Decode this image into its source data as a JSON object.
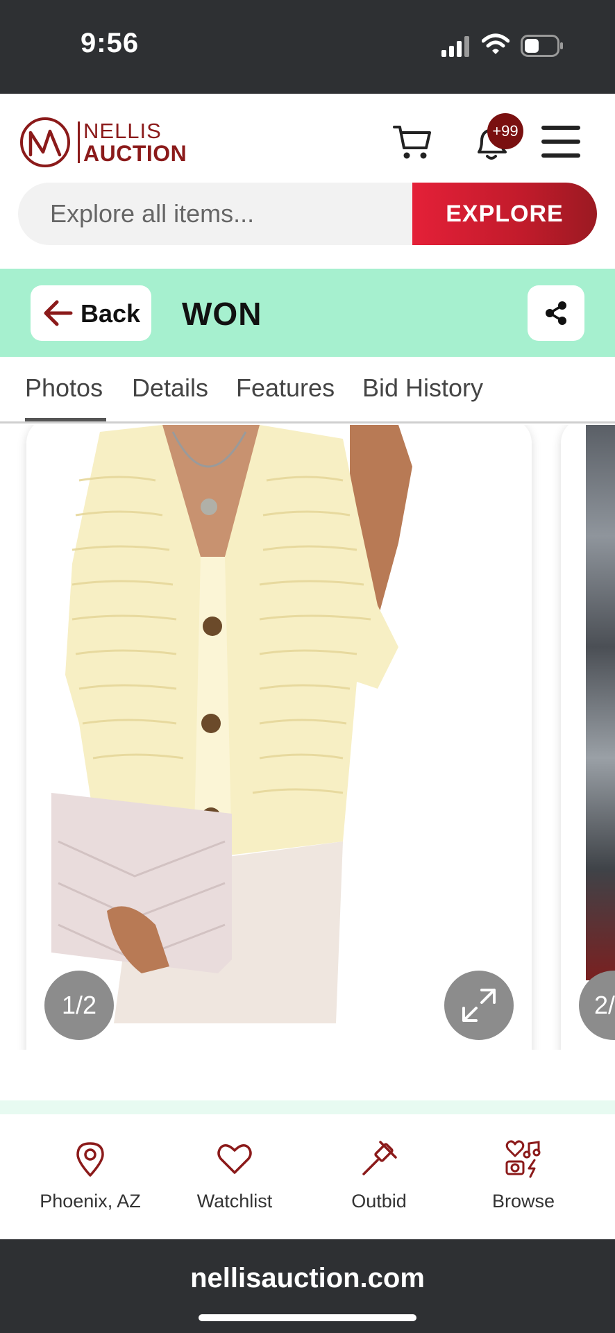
{
  "status_bar": {
    "time": "9:56"
  },
  "header": {
    "logo_line1": "NELLIS",
    "logo_line2": "AUCTION",
    "notification_badge": "+99",
    "brand_color": "#8b1a1a"
  },
  "search": {
    "placeholder": "Explore all items...",
    "button_label": "EXPLORE"
  },
  "status_bar_lot": {
    "back_label": "Back",
    "status_label": "WON",
    "bar_color": "#a6f0cf"
  },
  "tabs": [
    {
      "label": "Photos",
      "active": true
    },
    {
      "label": "Details",
      "active": false
    },
    {
      "label": "Features",
      "active": false
    },
    {
      "label": "Bid History",
      "active": false
    }
  ],
  "gallery": {
    "counter_1": "1/2",
    "counter_2": "2/"
  },
  "bottom_nav": [
    {
      "label": "Phoenix, AZ",
      "icon": "location-pin-icon"
    },
    {
      "label": "Watchlist",
      "icon": "heart-icon"
    },
    {
      "label": "Outbid",
      "icon": "gavel-icon"
    },
    {
      "label": "Browse",
      "icon": "browse-categories-icon"
    }
  ],
  "browser": {
    "url": "nellisauction.com"
  }
}
